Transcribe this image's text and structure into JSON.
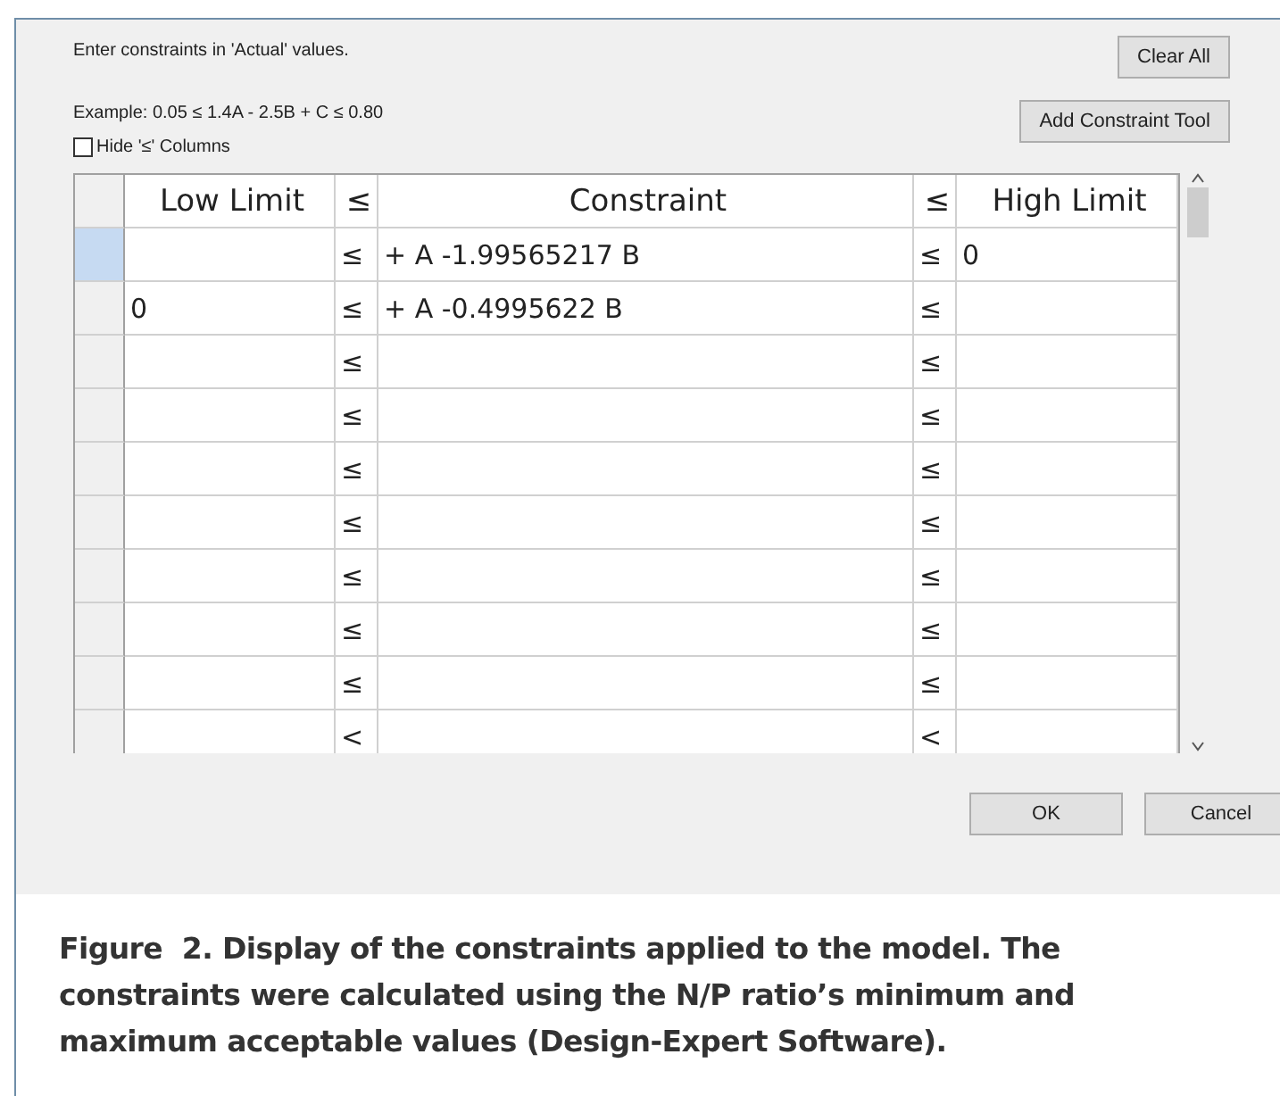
{
  "dialog": {
    "instruction": "Enter constraints in 'Actual' values.",
    "example": "Example: 0.05 ≤ 1.4A - 2.5B + C ≤ 0.80",
    "hide_columns": {
      "label": "Hide '≤' Columns",
      "checked": false
    },
    "buttons_top": [
      "Clear All",
      "Add Constraint Tool"
    ],
    "table": {
      "columns": [
        "Low Limit",
        "≤",
        "Constraint",
        "≤",
        "High Limit"
      ],
      "rows": [
        {
          "selected": true,
          "cells": [
            "",
            "≤",
            "+ A  -1.99565217 B",
            "≤",
            "0"
          ]
        },
        {
          "selected": false,
          "cells": [
            "0",
            "≤",
            "+ A  -0.4995622 B",
            "≤",
            ""
          ]
        },
        {
          "selected": false,
          "cells": [
            "",
            "≤",
            "",
            "≤",
            ""
          ]
        },
        {
          "selected": false,
          "cells": [
            "",
            "≤",
            "",
            "≤",
            ""
          ]
        },
        {
          "selected": false,
          "cells": [
            "",
            "≤",
            "",
            "≤",
            ""
          ]
        },
        {
          "selected": false,
          "cells": [
            "",
            "≤",
            "",
            "≤",
            ""
          ]
        },
        {
          "selected": false,
          "cells": [
            "",
            "≤",
            "",
            "≤",
            ""
          ]
        },
        {
          "selected": false,
          "cells": [
            "",
            "≤",
            "",
            "≤",
            ""
          ]
        },
        {
          "selected": false,
          "cells": [
            "",
            "≤",
            "",
            "≤",
            ""
          ]
        },
        {
          "selected": false,
          "cells": [
            "",
            "<",
            "",
            "<",
            ""
          ]
        }
      ]
    },
    "buttons_bottom": [
      "OK",
      "Cancel"
    ]
  },
  "caption": "Figure  2. Display of the constraints applied to the model. The constraints were calculated using the N/P ratio’s minimum and maximum acceptable values (Design-Expert Software)."
}
